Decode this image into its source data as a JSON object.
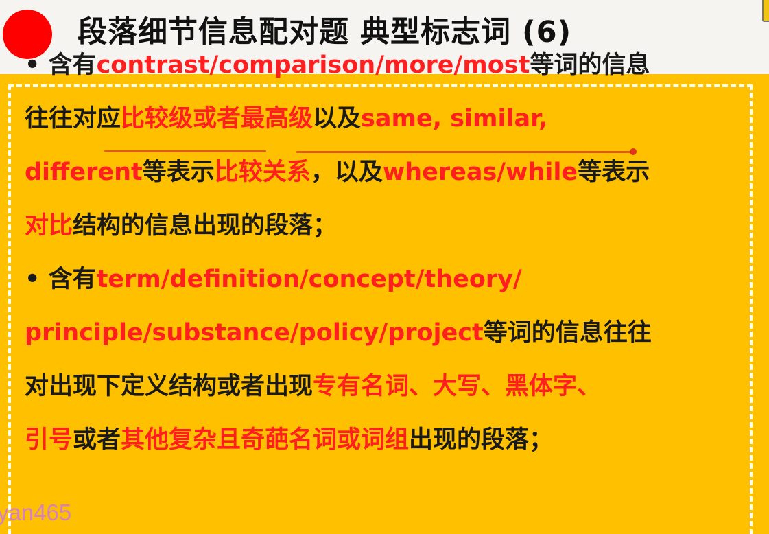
{
  "header": {
    "title": "段落细节信息配对题  典型标志词 (6)"
  },
  "colors": {
    "accent_red": "#ff1f1f",
    "slide_background": "#ffc000",
    "dot_red": "#ff0000"
  },
  "content": {
    "l1_bullet": "• 含有",
    "l1_red": "contrast/comparison/more/most",
    "l1_black": "等词的信息",
    "l2_black1": "往往对应",
    "l2_red1": "比较级或者最高级",
    "l2_black2": "以及",
    "l2_red2": "same, similar,",
    "l3_red1": "different",
    "l3_black1": "等表示",
    "l3_red2": "比较关系",
    "l3_black2": "，以及",
    "l3_red3": "whereas/while",
    "l3_black3": "等表示",
    "l4_red": "对比",
    "l4_black": "结构的信息出现的段落；",
    "l5_bullet": "• 含有",
    "l5_red": "term/definition/concept/theory/",
    "l6_red": "principle/substance/policy/project",
    "l6_black": "等词的信息往往",
    "l7_black": "对出现下定义结构或者出现",
    "l7_red": "专有名词、大写、黑体字、",
    "l8_red1": "引号",
    "l8_black1": "或者",
    "l8_red2": "其他复杂且奇葩名词或词组",
    "l8_black2": "出现的段落；"
  },
  "watermark": "yan465"
}
